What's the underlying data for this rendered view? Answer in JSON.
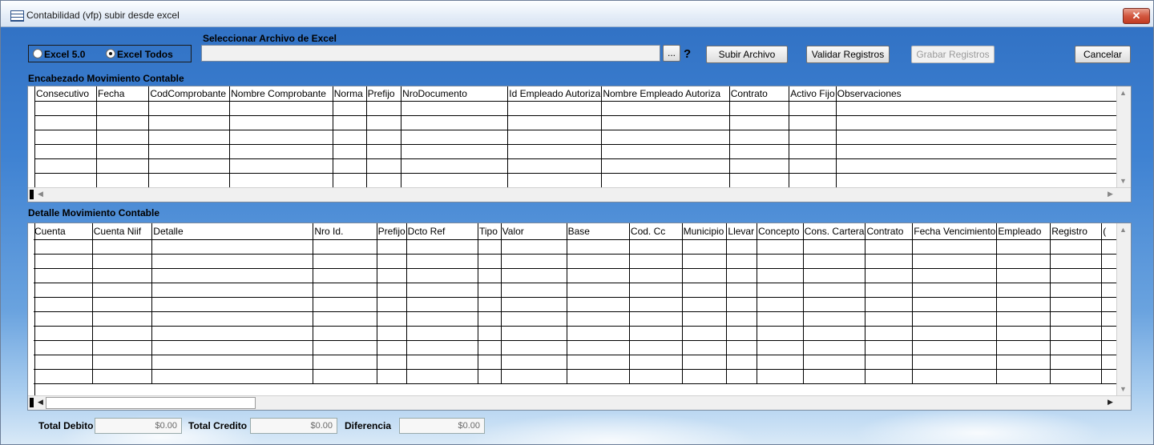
{
  "window": {
    "title": "Contabilidad (vfp) subir desde excel",
    "close_glyph": "✕"
  },
  "format": {
    "options": [
      "Excel 5.0",
      "Excel Todos"
    ],
    "selected": "Excel Todos"
  },
  "file": {
    "label": "Seleccionar Archivo de Excel",
    "value": "",
    "browse_label": "...",
    "help_label": "?"
  },
  "buttons": {
    "subir": "Subir Archivo",
    "validar": "Validar Registros",
    "grabar": "Grabar Registros",
    "cancelar": "Cancelar"
  },
  "header_grid": {
    "title": "Encabezado Movimiento Contable",
    "columns": [
      "Consecutivo",
      "Fecha",
      "CodComprobante",
      "Nombre Comprobante",
      "Norma",
      "Prefijo",
      "NroDocumento",
      "Id Empleado Autoriza",
      "Nombre Empleado Autoriza",
      "Contrato",
      "Activo Fijo",
      "Observaciones"
    ],
    "row_count": 6
  },
  "detail_grid": {
    "title": "Detalle Movimiento Contable",
    "columns": [
      "Cuenta",
      "Cuenta Niif",
      "Detalle",
      "Nro Id.",
      "Prefijo",
      "Dcto Ref",
      "Tipo",
      "Valor",
      "Base",
      "Cod. Cc",
      "Municipio",
      "Llevar",
      "Concepto",
      "Cons. Cartera",
      "Contrato",
      "Fecha Vencimiento",
      "Empleado",
      "Registro",
      "("
    ],
    "row_count": 10
  },
  "totals": {
    "debito_label": "Total Debito",
    "debito_value": "$0.00",
    "credito_label": "Total Credito",
    "credito_value": "$0.00",
    "diferencia_label": "Diferencia",
    "diferencia_value": "$0.00"
  },
  "icons": {
    "window": "table-icon",
    "close": "close-icon"
  },
  "colors": {
    "background_top": "#2f6fc2",
    "close_button": "#c13b22"
  }
}
